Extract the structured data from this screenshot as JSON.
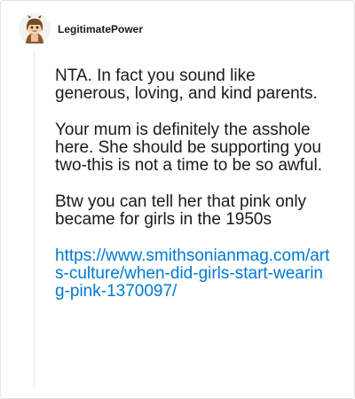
{
  "post": {
    "username": "LegitimatePower",
    "avatar_icon": "snoo-avatar-icon",
    "paragraphs": [
      "NTA. In fact you sound like generous, loving, and kind parents.",
      "Your mum is definitely the asshole here. She should be supporting you two-this is not a time to be so awful.",
      "Btw you can tell her that pink only became for girls in the 1950s"
    ],
    "link": "https://www.smithsonianmag.com/arts-culture/when-did-girls-start-wearing-pink-1370097/"
  },
  "colors": {
    "link": "#0079d3",
    "text": "#1a1a1a",
    "border": "#e3e3e3"
  }
}
